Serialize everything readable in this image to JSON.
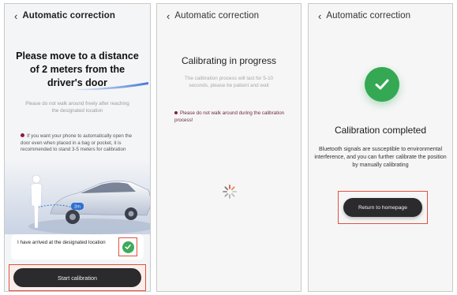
{
  "screens": [
    {
      "header_title": "Automatic correction",
      "headline": "Please move to a distance of 2 meters from the driver's door",
      "subnote": "Please do not walk around freely after reaching the designated location",
      "tip": "If you want your phone to automatically open the door even when placed in a bag or pocket, it is recommended to stand 3-5 meters for calibration",
      "distance_label": "2m",
      "arrive_label": "I have arrived at the designated location",
      "arrive_checked": true,
      "start_button": "Start calibration"
    },
    {
      "header_title": "Automatic correction",
      "title": "Calibrating in progress",
      "description": "The calibration process will last for 5-10 seconds, please be patient and wait",
      "warning": "Please do not walk around during the calibration process!"
    },
    {
      "header_title": "Automatic correction",
      "title": "Calibration completed",
      "description": "Bluetooth signals are susceptible to environmental interference, and you can further calibrate the position by manually calibrating",
      "return_button": "Return to homepage"
    }
  ],
  "colors": {
    "accent_green": "#34a853",
    "highlight_red": "#e2513d",
    "button_dark": "#2b2b2d",
    "warning_dot": "#8a1d3a"
  },
  "icons": [
    "chevron-left-icon",
    "checkmark-icon",
    "loading-spinner-icon"
  ]
}
